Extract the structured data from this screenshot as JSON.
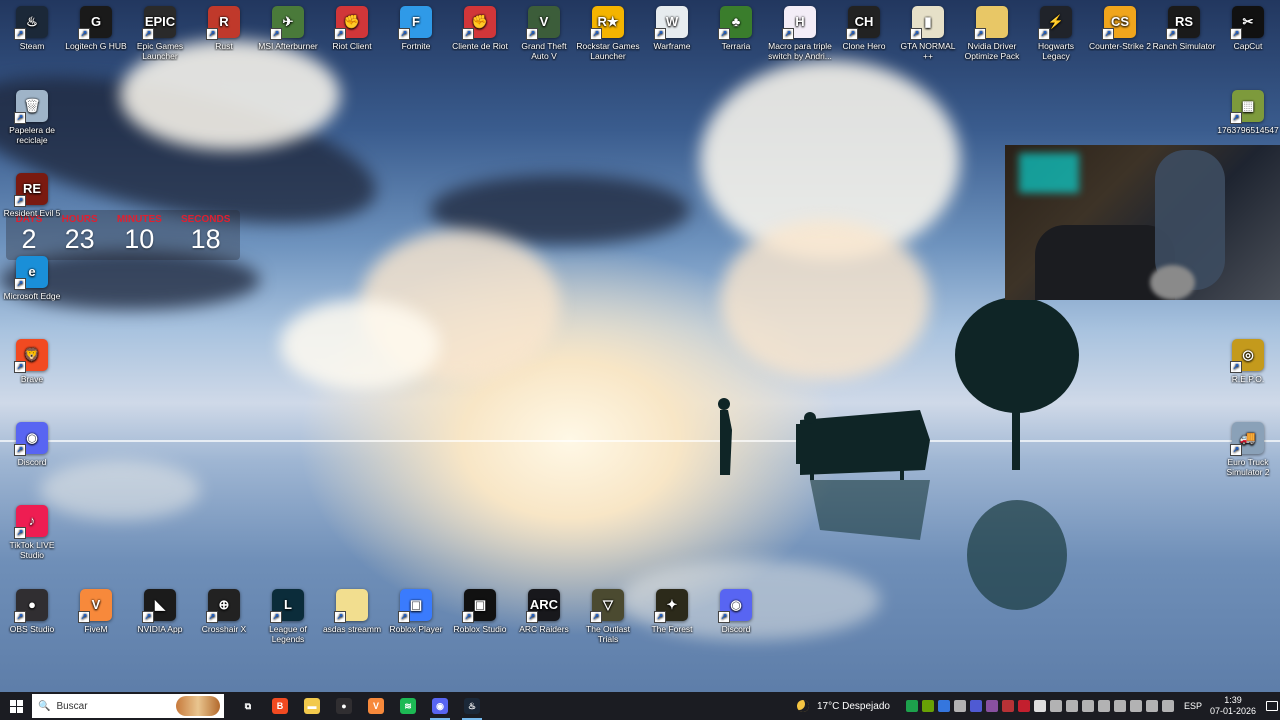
{
  "desktop": {
    "top_row": [
      {
        "name": "steam",
        "label": "Steam",
        "glyph": "♨",
        "color": "#1b2838"
      },
      {
        "name": "logitech-g-hub",
        "label": "Logitech G HUB",
        "glyph": "G",
        "color": "#1a1a1a"
      },
      {
        "name": "epic-games-launcher",
        "label": "Epic Games Launcher",
        "glyph": "EPIC",
        "color": "#2a2a2a"
      },
      {
        "name": "rust",
        "label": "Rust",
        "glyph": "R",
        "color": "#c0392b"
      },
      {
        "name": "msi-afterburner",
        "label": "MSI Afterburner",
        "glyph": "✈",
        "color": "#4a7a3a"
      },
      {
        "name": "riot-client",
        "label": "Riot Client",
        "glyph": "✊",
        "color": "#d13639"
      },
      {
        "name": "fortnite",
        "label": "Fortnite",
        "glyph": "F",
        "color": "#2f9ae8"
      },
      {
        "name": "cliente-de-riot",
        "label": "Cliente de Riot",
        "glyph": "✊",
        "color": "#d13639"
      },
      {
        "name": "grand-theft-auto-v",
        "label": "Grand Theft Auto V",
        "glyph": "V",
        "color": "#3c5d3a"
      },
      {
        "name": "rockstar-games-launcher",
        "label": "Rockstar Games Launcher",
        "glyph": "R★",
        "color": "#f4b400"
      },
      {
        "name": "warframe",
        "label": "Warframe",
        "glyph": "W",
        "color": "#e7ecef"
      },
      {
        "name": "terraria",
        "label": "Terraria",
        "glyph": "♣",
        "color": "#3a7d2c"
      },
      {
        "name": "macro-triple-switch",
        "label": "Macro para triple switch by Andri...",
        "glyph": "H",
        "color": "#f3edf7"
      },
      {
        "name": "clone-hero",
        "label": "Clone Hero",
        "glyph": "CH",
        "color": "#222222"
      },
      {
        "name": "gta-normal",
        "label": "GTA NORMAL ++",
        "glyph": "▮",
        "color": "#e6e0c8"
      },
      {
        "name": "nvidia-driver-optimize-pack",
        "label": "Nvidia Driver Optimize Pack",
        "glyph": "",
        "color": "#e8c766"
      },
      {
        "name": "hogwarts-legacy",
        "label": "Hogwarts Legacy",
        "glyph": "⚡",
        "color": "#20232a"
      },
      {
        "name": "counter-strike-2",
        "label": "Counter-Strike 2",
        "glyph": "CS",
        "color": "#f0a51c"
      },
      {
        "name": "ranch-simulator",
        "label": "Ranch Simulator",
        "glyph": "RS",
        "color": "#1a1a1a"
      },
      {
        "name": "capcut",
        "label": "CapCut",
        "glyph": "✂",
        "color": "#111111"
      }
    ],
    "left_column": [
      {
        "name": "papelera-de-reciclaje",
        "label": "Papelera de reciclaje",
        "glyph": "🗑",
        "color": "#9fb4c8"
      },
      {
        "name": "resident-evil-5",
        "label": "Resident Evil 5",
        "glyph": "RE",
        "color": "#7a1a10"
      },
      {
        "name": "microsoft-edge",
        "label": "Microsoft Edge",
        "glyph": "e",
        "color": "#1a8fd8"
      },
      {
        "name": "brave",
        "label": "Brave",
        "glyph": "🦁",
        "color": "#f14a21"
      },
      {
        "name": "discord",
        "label": "Discord",
        "glyph": "◉",
        "color": "#5865f2"
      },
      {
        "name": "tiktok-live-studio",
        "label": "TikTok LIVE Studio",
        "glyph": "♪",
        "color": "#ee1d52"
      }
    ],
    "bottom_row": [
      {
        "name": "obs-studio",
        "label": "OBS Studio",
        "glyph": "●",
        "color": "#302e31"
      },
      {
        "name": "fivem",
        "label": "FiveM",
        "glyph": "V",
        "color": "#f7893b"
      },
      {
        "name": "nvidia-app",
        "label": "NVIDIA App",
        "glyph": "◣",
        "color": "#1b1b1b"
      },
      {
        "name": "crosshair-x",
        "label": "Crosshair X",
        "glyph": "⊕",
        "color": "#222222"
      },
      {
        "name": "league-of-legends",
        "label": "League of Legends",
        "glyph": "L",
        "color": "#0b2c3a"
      },
      {
        "name": "asdas-streamm",
        "label": "asdas streamm",
        "glyph": "",
        "color": "#f2de8f"
      },
      {
        "name": "roblox-player",
        "label": "Roblox Player",
        "glyph": "▣",
        "color": "#3a7bfd"
      },
      {
        "name": "roblox-studio",
        "label": "Roblox Studio",
        "glyph": "▣",
        "color": "#111111"
      },
      {
        "name": "arc-raiders",
        "label": "ARC Raiders",
        "glyph": "ARC",
        "color": "#18181c"
      },
      {
        "name": "the-outlast-trials",
        "label": "The Outlast Trials",
        "glyph": "▽",
        "color": "#4b4a30"
      },
      {
        "name": "the-forest",
        "label": "The Forest",
        "glyph": "✦",
        "color": "#2c2a1a"
      },
      {
        "name": "discord-bottom",
        "label": "Discord",
        "glyph": "◉",
        "color": "#5865f2"
      }
    ],
    "right_column": [
      {
        "name": "screenshot-file",
        "label": "1763796514547",
        "glyph": "▦",
        "color": "#7d9a3c"
      },
      {
        "name": "repo",
        "label": "R.E.P.O.",
        "glyph": "◎",
        "color": "#c49a1c"
      },
      {
        "name": "euro-truck-simulator-2",
        "label": "Euro Truck Simulator 2",
        "glyph": "🚚",
        "color": "#8aa1b8"
      }
    ]
  },
  "countdown": {
    "days_label": "DAYS",
    "days": "2",
    "hours_label": "HOURS",
    "hours": "23",
    "minutes_label": "MINUTES",
    "minutes": "10",
    "seconds_label": "SECONDS",
    "seconds": "18"
  },
  "taskbar": {
    "search_placeholder": "Buscar",
    "pinned": [
      {
        "name": "task-view",
        "glyph": "⧉",
        "color": "transparent"
      },
      {
        "name": "brave",
        "glyph": "B",
        "color": "#f14a21"
      },
      {
        "name": "file-explorer",
        "glyph": "▬",
        "color": "#f2c94c"
      },
      {
        "name": "obs-studio",
        "glyph": "●",
        "color": "#302e31"
      },
      {
        "name": "fivem",
        "glyph": "V",
        "color": "#f7893b"
      },
      {
        "name": "spotify",
        "glyph": "≋",
        "color": "#1db954"
      },
      {
        "name": "discord",
        "glyph": "◉",
        "color": "#5865f2",
        "active": true
      },
      {
        "name": "steam",
        "glyph": "♨",
        "color": "#1b2838",
        "active": true
      }
    ],
    "weather_temp": "17°C",
    "weather_desc": "Despejado",
    "language": "ESP",
    "time": "1:39",
    "date": "07-01-2026",
    "tray_colors": [
      "#1db954",
      "#76b900",
      "#3a86ff",
      "#cccccc",
      "#5865f2",
      "#9b59b6",
      "#d13639",
      "#e02030",
      "#ffffff",
      "#cccccc",
      "#cccccc",
      "#cccccc",
      "#cccccc",
      "#cccccc",
      "#cccccc",
      "#cccccc",
      "#cccccc"
    ]
  }
}
